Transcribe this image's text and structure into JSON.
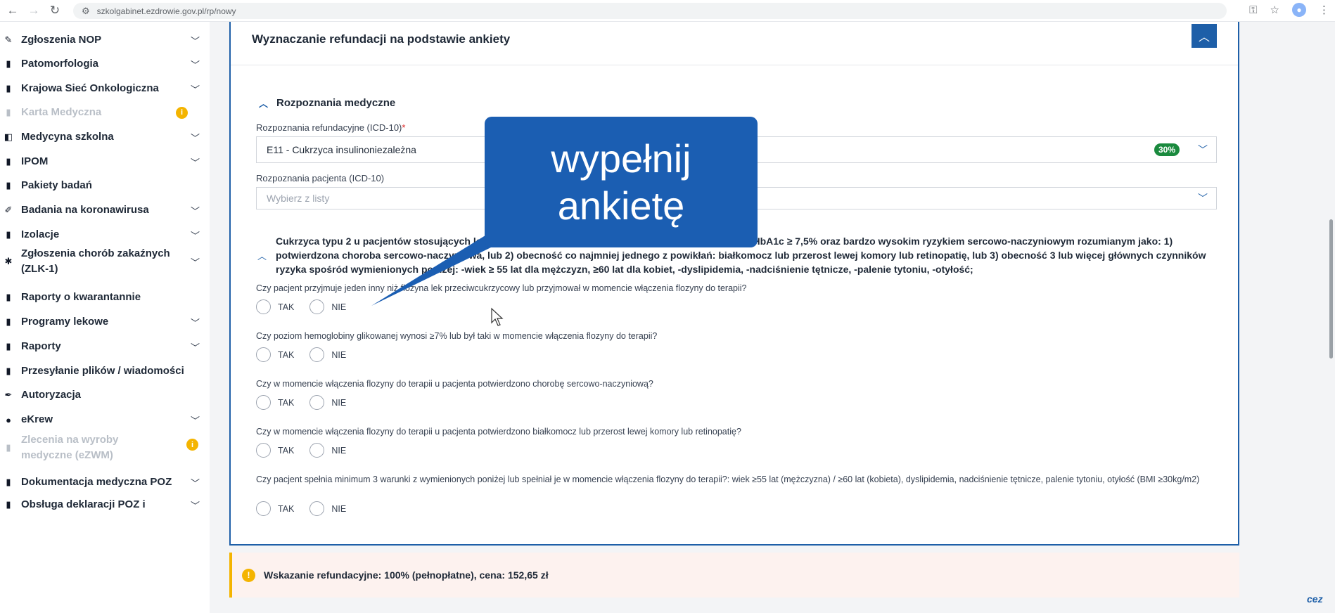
{
  "browser": {
    "url": "szkolgabinet.ezdrowie.gov.pl/rp/nowy"
  },
  "sidebar": {
    "items": [
      {
        "label": "Zgłoszenia NOP",
        "icon": "pen-icon",
        "glyph": "✎",
        "chevron": true,
        "disabled": false
      },
      {
        "label": "Patomorfologia",
        "icon": "clipboard-icon",
        "glyph": "▮",
        "chevron": true,
        "disabled": false
      },
      {
        "label": "Krajowa Sieć Onkologiczna",
        "icon": "clipboard-icon",
        "glyph": "▮",
        "chevron": true,
        "disabled": false
      },
      {
        "label": "Karta Medyczna",
        "icon": "card-icon",
        "glyph": "▮",
        "chevron": false,
        "disabled": true,
        "info": true
      },
      {
        "label": "Medycyna szkolna",
        "icon": "book-icon",
        "glyph": "◧",
        "chevron": true,
        "disabled": false
      },
      {
        "label": "IPOM",
        "icon": "clipboard-icon",
        "glyph": "▮",
        "chevron": true,
        "disabled": false
      },
      {
        "label": "Pakiety badań",
        "icon": "document-icon",
        "glyph": "▮",
        "chevron": false,
        "disabled": false
      },
      {
        "label": "Badania na koronawirusa",
        "icon": "syringe-icon",
        "glyph": "✐",
        "chevron": true,
        "disabled": false
      },
      {
        "label": "Izolacje",
        "icon": "clipboard-icon",
        "glyph": "▮",
        "chevron": true,
        "disabled": false
      },
      {
        "label": "Zgłoszenia chorób zakaźnych (ZLK-1)",
        "icon": "virus-icon",
        "glyph": "✱",
        "chevron": true,
        "disabled": false
      },
      {
        "label": "Raporty o kwarantannie",
        "icon": "document-icon",
        "glyph": "▮",
        "chevron": false,
        "disabled": false
      },
      {
        "label": "Programy lekowe",
        "icon": "clipboard-icon",
        "glyph": "▮",
        "chevron": true,
        "disabled": false
      },
      {
        "label": "Raporty",
        "icon": "clipboard-icon",
        "glyph": "▮",
        "chevron": true,
        "disabled": false
      },
      {
        "label": "Przesyłanie plików / wiadomości",
        "icon": "document-icon",
        "glyph": "▮",
        "chevron": false,
        "disabled": false
      },
      {
        "label": "Autoryzacja",
        "icon": "pen-icon",
        "glyph": "✒",
        "chevron": false,
        "disabled": false
      },
      {
        "label": "eKrew",
        "icon": "blood-drop-icon",
        "glyph": "●",
        "chevron": true,
        "disabled": false
      },
      {
        "label": "Zlecenia na wyroby medyczne (eZWM)",
        "icon": "clipboard-icon",
        "glyph": "▮",
        "chevron": false,
        "disabled": true,
        "info": true
      },
      {
        "label": "Dokumentacja medyczna POZ",
        "icon": "clipboard-icon",
        "glyph": "▮",
        "chevron": true,
        "disabled": false
      },
      {
        "label": "Obsługa deklaracji POZ i",
        "icon": "document-icon",
        "glyph": "▮",
        "chevron": true,
        "disabled": false
      }
    ]
  },
  "panel": {
    "title": "Wyznaczanie refundacji na podstawie ankiety",
    "section_title": "Rozpoznania medyczne",
    "refund_diagnosis": {
      "label": "Rozpoznania refundacyjne (ICD-10)",
      "required_mark": "*",
      "value": "E11 - Cukrzyca insulinoniezależna",
      "badge": "30%"
    },
    "patient_diagnosis": {
      "label": "Rozpoznania pacjenta (ICD-10)",
      "placeholder": "Wybierz z listy"
    },
    "group_description": "Cukrzyca typu 2 u pacjentów stosujących leczenie co najmniej jednym lekiem przeciwcukrzycowym z HbA1c ≥ 7,5% oraz bardzo wysokim ryzykiem sercowo-naczyniowym rozumianym jako: 1) potwierdzona choroba sercowo-naczyniowa, lub 2) obecność co najmniej jednego z powikłań: białkomocz lub przerost lewej komory lub retinopatię, lub 3) obecność 3 lub więcej głównych czynników ryzyka spośród wymienionych poniżej: -wiek ≥ 55 lat dla mężczyzn, ≥60 lat dla kobiet, -dyslipidemia, -nadciśnienie tętnicze, -palenie tytoniu, -otyłość;",
    "questions": [
      {
        "text": "Czy pacjent przyjmuje jeden inny niż flozyna lek przeciwcukrzycowy lub przyjmował w momencie włączenia flozyny do terapii?",
        "yes": "TAK",
        "no": "NIE"
      },
      {
        "text": "Czy poziom hemoglobiny glikowanej wynosi ≥7% lub był taki w momencie włączenia flozyny do terapii?",
        "yes": "TAK",
        "no": "NIE"
      },
      {
        "text": "Czy w momencie włączenia flozyny do terapii u pacjenta potwierdzono chorobę sercowo-naczyniową?",
        "yes": "TAK",
        "no": "NIE"
      },
      {
        "text": "Czy w momencie włączenia flozyny do terapii u pacjenta potwierdzono białkomocz lub przerost lewej komory lub retinopatię?",
        "yes": "TAK",
        "no": "NIE"
      },
      {
        "text": "Czy pacjent spełnia minimum 3 warunki z wymienionych poniżej lub spełniał je w momencie włączenia flozyny do terapii?: wiek ≥55 lat (mężczyzna) / ≥60 lat (kobieta), dyslipidemia, nadciśnienie tętnicze, palenie tytoniu, otyłość (BMI ≥30kg/m2)",
        "yes": "TAK",
        "no": "NIE"
      }
    ]
  },
  "alert": {
    "text": "Wskazanie refundacyjne: 100% (pełnopłatne), cena: 152,65 zł"
  },
  "overlay": {
    "line1": "wypełnij",
    "line2": "ankietę"
  },
  "corner_logo": "cez",
  "colors": {
    "primary": "#1e5fa8",
    "callout": "#1b5eb2",
    "badge_green": "#1a8a3e",
    "warning": "#f4b400",
    "alert_bg": "#fdf2ef"
  }
}
